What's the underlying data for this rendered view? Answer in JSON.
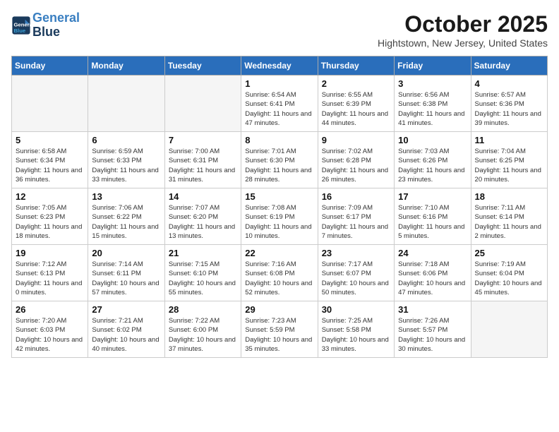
{
  "header": {
    "logo_line1": "General",
    "logo_line2": "Blue",
    "month": "October 2025",
    "location": "Hightstown, New Jersey, United States"
  },
  "weekdays": [
    "Sunday",
    "Monday",
    "Tuesday",
    "Wednesday",
    "Thursday",
    "Friday",
    "Saturday"
  ],
  "weeks": [
    [
      {
        "day": "",
        "info": "",
        "empty": true
      },
      {
        "day": "",
        "info": "",
        "empty": true
      },
      {
        "day": "",
        "info": "",
        "empty": true
      },
      {
        "day": "1",
        "info": "Sunrise: 6:54 AM\nSunset: 6:41 PM\nDaylight: 11 hours\nand 47 minutes.",
        "empty": false
      },
      {
        "day": "2",
        "info": "Sunrise: 6:55 AM\nSunset: 6:39 PM\nDaylight: 11 hours\nand 44 minutes.",
        "empty": false
      },
      {
        "day": "3",
        "info": "Sunrise: 6:56 AM\nSunset: 6:38 PM\nDaylight: 11 hours\nand 41 minutes.",
        "empty": false
      },
      {
        "day": "4",
        "info": "Sunrise: 6:57 AM\nSunset: 6:36 PM\nDaylight: 11 hours\nand 39 minutes.",
        "empty": false
      }
    ],
    [
      {
        "day": "5",
        "info": "Sunrise: 6:58 AM\nSunset: 6:34 PM\nDaylight: 11 hours\nand 36 minutes.",
        "empty": false
      },
      {
        "day": "6",
        "info": "Sunrise: 6:59 AM\nSunset: 6:33 PM\nDaylight: 11 hours\nand 33 minutes.",
        "empty": false
      },
      {
        "day": "7",
        "info": "Sunrise: 7:00 AM\nSunset: 6:31 PM\nDaylight: 11 hours\nand 31 minutes.",
        "empty": false
      },
      {
        "day": "8",
        "info": "Sunrise: 7:01 AM\nSunset: 6:30 PM\nDaylight: 11 hours\nand 28 minutes.",
        "empty": false
      },
      {
        "day": "9",
        "info": "Sunrise: 7:02 AM\nSunset: 6:28 PM\nDaylight: 11 hours\nand 26 minutes.",
        "empty": false
      },
      {
        "day": "10",
        "info": "Sunrise: 7:03 AM\nSunset: 6:26 PM\nDaylight: 11 hours\nand 23 minutes.",
        "empty": false
      },
      {
        "day": "11",
        "info": "Sunrise: 7:04 AM\nSunset: 6:25 PM\nDaylight: 11 hours\nand 20 minutes.",
        "empty": false
      }
    ],
    [
      {
        "day": "12",
        "info": "Sunrise: 7:05 AM\nSunset: 6:23 PM\nDaylight: 11 hours\nand 18 minutes.",
        "empty": false
      },
      {
        "day": "13",
        "info": "Sunrise: 7:06 AM\nSunset: 6:22 PM\nDaylight: 11 hours\nand 15 minutes.",
        "empty": false
      },
      {
        "day": "14",
        "info": "Sunrise: 7:07 AM\nSunset: 6:20 PM\nDaylight: 11 hours\nand 13 minutes.",
        "empty": false
      },
      {
        "day": "15",
        "info": "Sunrise: 7:08 AM\nSunset: 6:19 PM\nDaylight: 11 hours\nand 10 minutes.",
        "empty": false
      },
      {
        "day": "16",
        "info": "Sunrise: 7:09 AM\nSunset: 6:17 PM\nDaylight: 11 hours\nand 7 minutes.",
        "empty": false
      },
      {
        "day": "17",
        "info": "Sunrise: 7:10 AM\nSunset: 6:16 PM\nDaylight: 11 hours\nand 5 minutes.",
        "empty": false
      },
      {
        "day": "18",
        "info": "Sunrise: 7:11 AM\nSunset: 6:14 PM\nDaylight: 11 hours\nand 2 minutes.",
        "empty": false
      }
    ],
    [
      {
        "day": "19",
        "info": "Sunrise: 7:12 AM\nSunset: 6:13 PM\nDaylight: 11 hours\nand 0 minutes.",
        "empty": false
      },
      {
        "day": "20",
        "info": "Sunrise: 7:14 AM\nSunset: 6:11 PM\nDaylight: 10 hours\nand 57 minutes.",
        "empty": false
      },
      {
        "day": "21",
        "info": "Sunrise: 7:15 AM\nSunset: 6:10 PM\nDaylight: 10 hours\nand 55 minutes.",
        "empty": false
      },
      {
        "day": "22",
        "info": "Sunrise: 7:16 AM\nSunset: 6:08 PM\nDaylight: 10 hours\nand 52 minutes.",
        "empty": false
      },
      {
        "day": "23",
        "info": "Sunrise: 7:17 AM\nSunset: 6:07 PM\nDaylight: 10 hours\nand 50 minutes.",
        "empty": false
      },
      {
        "day": "24",
        "info": "Sunrise: 7:18 AM\nSunset: 6:06 PM\nDaylight: 10 hours\nand 47 minutes.",
        "empty": false
      },
      {
        "day": "25",
        "info": "Sunrise: 7:19 AM\nSunset: 6:04 PM\nDaylight: 10 hours\nand 45 minutes.",
        "empty": false
      }
    ],
    [
      {
        "day": "26",
        "info": "Sunrise: 7:20 AM\nSunset: 6:03 PM\nDaylight: 10 hours\nand 42 minutes.",
        "empty": false
      },
      {
        "day": "27",
        "info": "Sunrise: 7:21 AM\nSunset: 6:02 PM\nDaylight: 10 hours\nand 40 minutes.",
        "empty": false
      },
      {
        "day": "28",
        "info": "Sunrise: 7:22 AM\nSunset: 6:00 PM\nDaylight: 10 hours\nand 37 minutes.",
        "empty": false
      },
      {
        "day": "29",
        "info": "Sunrise: 7:23 AM\nSunset: 5:59 PM\nDaylight: 10 hours\nand 35 minutes.",
        "empty": false
      },
      {
        "day": "30",
        "info": "Sunrise: 7:25 AM\nSunset: 5:58 PM\nDaylight: 10 hours\nand 33 minutes.",
        "empty": false
      },
      {
        "day": "31",
        "info": "Sunrise: 7:26 AM\nSunset: 5:57 PM\nDaylight: 10 hours\nand 30 minutes.",
        "empty": false
      },
      {
        "day": "",
        "info": "",
        "empty": true
      }
    ]
  ]
}
